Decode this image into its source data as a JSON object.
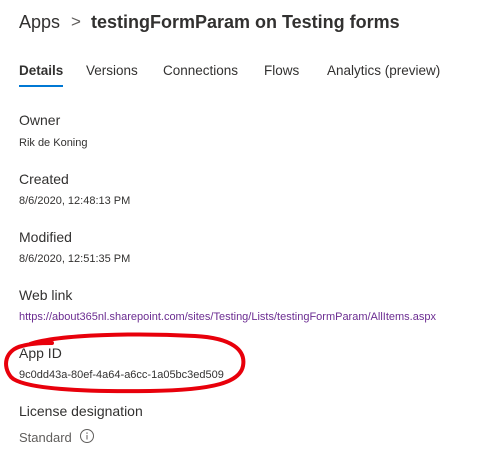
{
  "breadcrumb": {
    "root": "Apps",
    "separator": ">",
    "current": "testingFormParam on Testing forms"
  },
  "tabs": [
    {
      "label": "Details",
      "active": true
    },
    {
      "label": "Versions",
      "active": false
    },
    {
      "label": "Connections",
      "active": false
    },
    {
      "label": "Flows",
      "active": false
    },
    {
      "label": "Analytics (preview)",
      "active": false
    }
  ],
  "details": {
    "owner": {
      "label": "Owner",
      "value": "Rik de Koning"
    },
    "created": {
      "label": "Created",
      "value": "8/6/2020, 12:48:13 PM"
    },
    "modified": {
      "label": "Modified",
      "value": "8/6/2020, 12:51:35 PM"
    },
    "web_link": {
      "label": "Web link",
      "value": "https://about365nl.sharepoint.com/sites/Testing/Lists/testingFormParam/AllItems.aspx"
    },
    "app_id": {
      "label": "App ID",
      "value": "9c0dd43a-80ef-4a64-a6cc-1a05bc3ed509"
    },
    "license": {
      "label": "License designation",
      "value": "Standard"
    }
  },
  "icons": {
    "info": "info-circle-icon",
    "separator": "chevron-right-icon"
  },
  "colors": {
    "text": "#323130",
    "secondary_text": "#605e5c",
    "link": "#6b2c91",
    "accent": "#0078d4",
    "annotation": "#e8000b"
  }
}
